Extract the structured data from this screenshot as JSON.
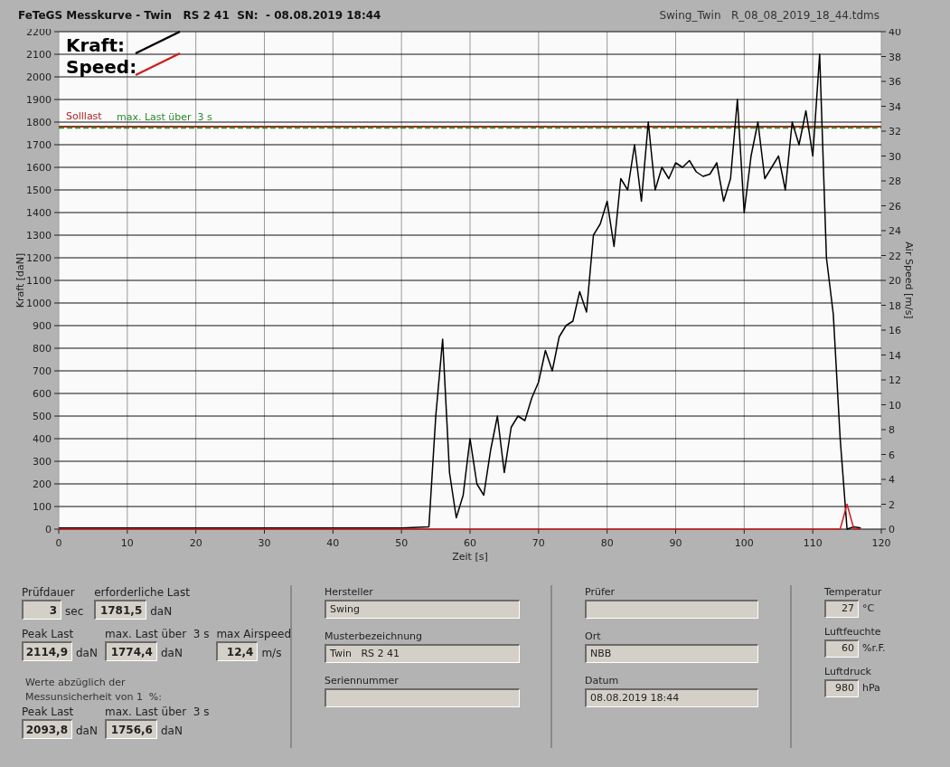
{
  "header": {
    "title": "FeTeGS Messkurve - Twin   RS 2 41  SN:  - 08.08.2019 18:44",
    "file": "Swing_Twin   R_08_08_2019_18_44.tdms"
  },
  "chart": {
    "chart_data": {
      "type": "line",
      "xlabel": "Zeit [s]",
      "ylabel": "Kraft [daN]",
      "y2label": "Air Speed [m/s]",
      "xlim": [
        0,
        120
      ],
      "ylim": [
        0,
        2200
      ],
      "y2lim": [
        0,
        40
      ],
      "y2ticks": [
        0,
        2,
        4,
        6,
        8,
        10,
        12,
        14,
        16,
        18,
        20,
        22,
        24,
        26,
        28,
        30,
        32,
        34,
        36,
        38,
        40
      ],
      "xticks": [
        0,
        10,
        20,
        30,
        40,
        50,
        60,
        70,
        80,
        90,
        100,
        110,
        120
      ],
      "yticks": [
        0,
        100,
        200,
        300,
        400,
        500,
        600,
        700,
        800,
        900,
        1000,
        1100,
        1200,
        1300,
        1400,
        1500,
        1600,
        1700,
        1800,
        1900,
        2000,
        2100,
        2200
      ],
      "x": [
        0,
        10,
        20,
        30,
        40,
        50,
        54,
        55,
        56,
        57,
        58,
        59,
        60,
        61,
        62,
        63,
        64,
        65,
        66,
        67,
        68,
        69,
        70,
        71,
        72,
        73,
        74,
        75,
        76,
        77,
        78,
        79,
        80,
        81,
        82,
        83,
        84,
        85,
        86,
        87,
        88,
        89,
        90,
        91,
        92,
        93,
        94,
        95,
        96,
        97,
        98,
        99,
        100,
        101,
        102,
        103,
        104,
        105,
        106,
        107,
        108,
        109,
        110,
        111,
        112,
        113,
        114,
        115,
        116,
        117
      ],
      "series": [
        {
          "name": "Kraft:",
          "color": "#000000",
          "values": [
            5,
            5,
            5,
            5,
            5,
            5,
            10,
            500,
            840,
            250,
            50,
            150,
            400,
            200,
            150,
            350,
            500,
            250,
            450,
            500,
            480,
            580,
            650,
            790,
            700,
            850,
            900,
            920,
            1050,
            960,
            1300,
            1350,
            1450,
            1250,
            1550,
            1500,
            1700,
            1450,
            1800,
            1500,
            1600,
            1550,
            1620,
            1600,
            1630,
            1580,
            1560,
            1570,
            1620,
            1450,
            1550,
            1900,
            1400,
            1650,
            1800,
            1550,
            1600,
            1650,
            1500,
            1800,
            1700,
            1850,
            1650,
            2100,
            1200,
            950,
            400,
            0,
            10,
            5
          ]
        },
        {
          "name": "Speed:",
          "color": "#cc1f1f",
          "axis": "y2",
          "values": [
            0,
            0,
            0,
            0,
            0,
            0,
            0,
            0,
            0,
            0,
            0,
            0,
            0,
            0,
            0,
            0,
            0,
            0,
            0,
            0,
            0,
            0,
            0,
            0,
            0,
            0,
            0,
            0,
            0,
            0,
            0,
            0,
            0,
            0,
            0,
            0,
            0,
            0,
            0,
            0,
            0,
            0,
            0,
            0,
            0,
            0,
            0,
            0,
            0,
            0,
            0,
            0,
            0,
            0,
            0,
            0,
            0,
            0,
            0,
            0,
            0,
            0,
            0,
            0,
            0,
            0,
            0,
            2,
            0,
            0
          ]
        }
      ],
      "ref_lines": [
        {
          "label": "Solllast",
          "axis": "y",
          "value": 1780,
          "color": "#b02020"
        },
        {
          "label": "max. Last über  3 s",
          "axis": "y",
          "value": 1775,
          "color": "#2a8a2a"
        }
      ],
      "grid": true,
      "legend": "upper left"
    }
  },
  "results": {
    "fields": [
      {
        "label": "Prüfdauer",
        "value": "3",
        "unit": "sec"
      },
      {
        "label": "erforderliche Last",
        "value": "1781,5",
        "unit": "daN"
      },
      {
        "label": "Peak Last",
        "value": "2114,9",
        "unit": "daN"
      },
      {
        "label": "max. Last über  3 s",
        "value": "1774,4",
        "unit": "daN"
      },
      {
        "label": "max Airspeed",
        "value": "12,4",
        "unit": "m/s"
      }
    ],
    "note": "Werte abzüglich der Messunsicherheit von 1  %:",
    "reduced": [
      {
        "label": "Peak Last",
        "value": "2093,8",
        "unit": "daN"
      },
      {
        "label": "max. Last über  3 s",
        "value": "1756,6",
        "unit": "daN"
      }
    ]
  },
  "info_left": [
    {
      "label": "Hersteller",
      "value": "Swing"
    },
    {
      "label": "Musterbezeichnung",
      "value": "Twin   RS 2 41"
    },
    {
      "label": "Seriennummer"
    }
  ],
  "info_right": [
    {
      "label": "Prüfer"
    },
    {
      "label": "Ort",
      "value": "NBB"
    },
    {
      "label": "Datum",
      "value": "08.08.2019 18:44"
    }
  ],
  "conditions": [
    {
      "label": "Temperatur",
      "value": "27",
      "unit": "°C"
    },
    {
      "label": "Luftfeuchte",
      "value": "60",
      "unit": "%r.F."
    },
    {
      "label": "Luftdruck",
      "value": "980",
      "unit": "hPa"
    }
  ]
}
